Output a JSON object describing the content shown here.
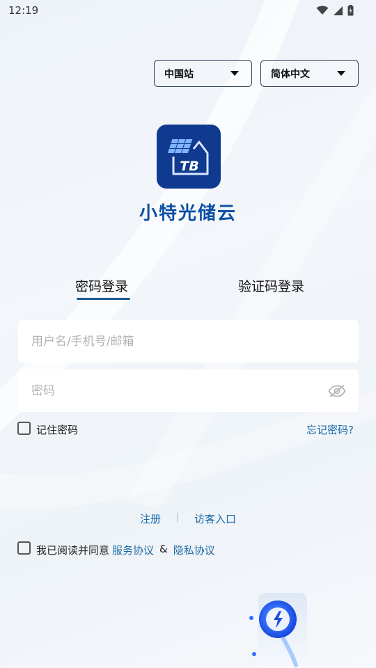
{
  "status_bar": {
    "time": "12:19"
  },
  "selectors": {
    "site": "中国站",
    "language": "简体中文"
  },
  "logo": {
    "badge_text": "TB"
  },
  "app": {
    "name": "小特光储云"
  },
  "tabs": [
    {
      "label": "密码登录",
      "active": true
    },
    {
      "label": "验证码登录",
      "active": false
    }
  ],
  "form": {
    "username_placeholder": "用户名/手机号/邮箱",
    "password_placeholder": "密码",
    "remember_label": "记住密码",
    "remember_checked": false,
    "forgot_label": "忘记密码?"
  },
  "links": {
    "register": "注册",
    "visitor": "访客入口"
  },
  "agreement": {
    "prefix": "我已阅读并同意",
    "service": "服务协议",
    "amp": "&",
    "privacy": "隐私协议",
    "checked": false
  },
  "colors": {
    "accent": "#1c6aa6",
    "brand": "#0d4fa3",
    "logo_bg": "#0f3a8f"
  },
  "icons": {
    "wifi": "wifi-icon",
    "signal": "signal-icon",
    "battery": "battery-icon",
    "eye_off": "eye-off-icon"
  }
}
